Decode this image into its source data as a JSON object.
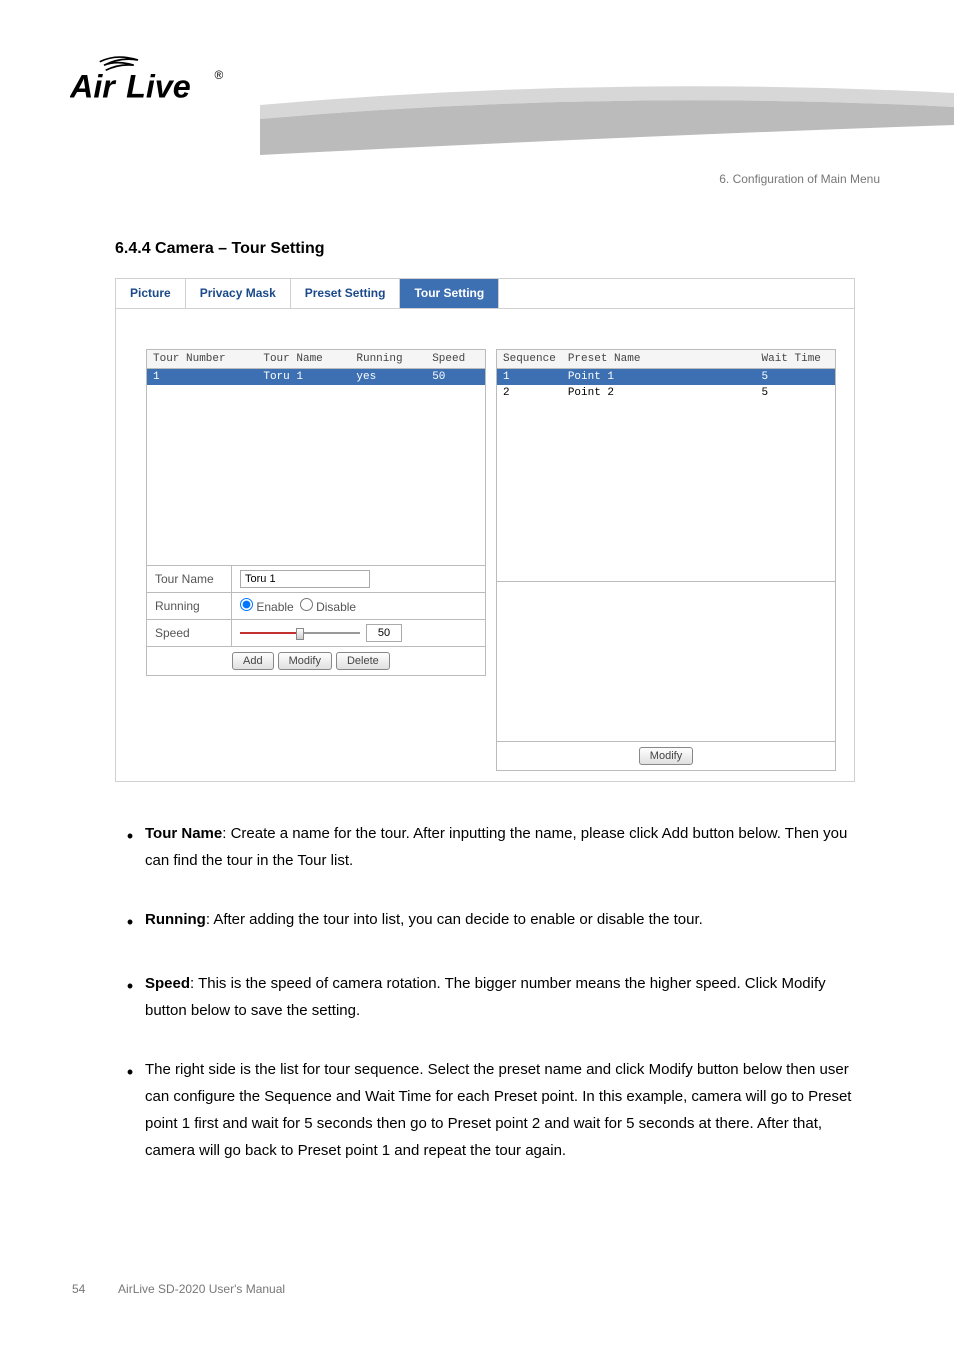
{
  "header": {
    "logo_text": "AirLive",
    "chapter": "6. Configuration of Main Menu"
  },
  "section_title": "6.4.4 Camera – Tour Setting",
  "tabs": {
    "items": [
      "Picture",
      "Privacy Mask",
      "Preset Setting",
      "Tour Setting"
    ],
    "active_index": 3
  },
  "tour_table": {
    "headers": [
      "Tour Number",
      "Tour Name",
      "Running",
      "Speed"
    ],
    "rows": [
      {
        "num": "1",
        "name": "Toru 1",
        "running": "yes",
        "speed": "50",
        "selected": true
      }
    ]
  },
  "seq_table": {
    "headers": [
      "Sequence",
      "Preset Name",
      "Wait Time"
    ],
    "rows": [
      {
        "seq": "1",
        "name": "Point 1",
        "wait": "5",
        "selected": true
      },
      {
        "seq": "2",
        "name": "Point 2",
        "wait": "5",
        "selected": false
      }
    ]
  },
  "form": {
    "tour_name_label": "Tour Name",
    "tour_name_value": "Toru 1",
    "running_label": "Running",
    "running_options": [
      "Enable",
      "Disable"
    ],
    "running_selected": 0,
    "speed_label": "Speed",
    "speed_value": "50"
  },
  "buttons": {
    "add": "Add",
    "modify": "Modify",
    "delete": "Delete",
    "modify_right": "Modify"
  },
  "bullets": [
    {
      "lead": "Tour Name",
      "bold_lead": true,
      "rest": ": Create a name for the tour. After inputting the name, please click Add button below. Then you can find the tour in the Tour list."
    },
    {
      "lead": "Running",
      "bold_lead": true,
      "rest": ": After adding the tour into list, you can decide to enable or disable the tour."
    },
    {
      "lead": "Speed",
      "bold_lead": true,
      "rest": ": This is the speed of camera rotation. The bigger number means the higher speed. Click Modify button below to save the setting."
    },
    {
      "lead": "The right side",
      "bold_lead": false,
      "rest": " is the list for tour sequence. Select the preset name and click Modify button below then user can configure the Sequence and Wait Time for each Preset point. In this example, camera will go to Preset point 1 first and wait for 5 seconds then go to Preset point 2 and wait for 5 seconds at there. After that, camera will go back to Preset point 1 and repeat the tour again."
    }
  ],
  "footer": {
    "page_number": "54",
    "manual_title": "AirLive SD-2020 User's Manual"
  }
}
